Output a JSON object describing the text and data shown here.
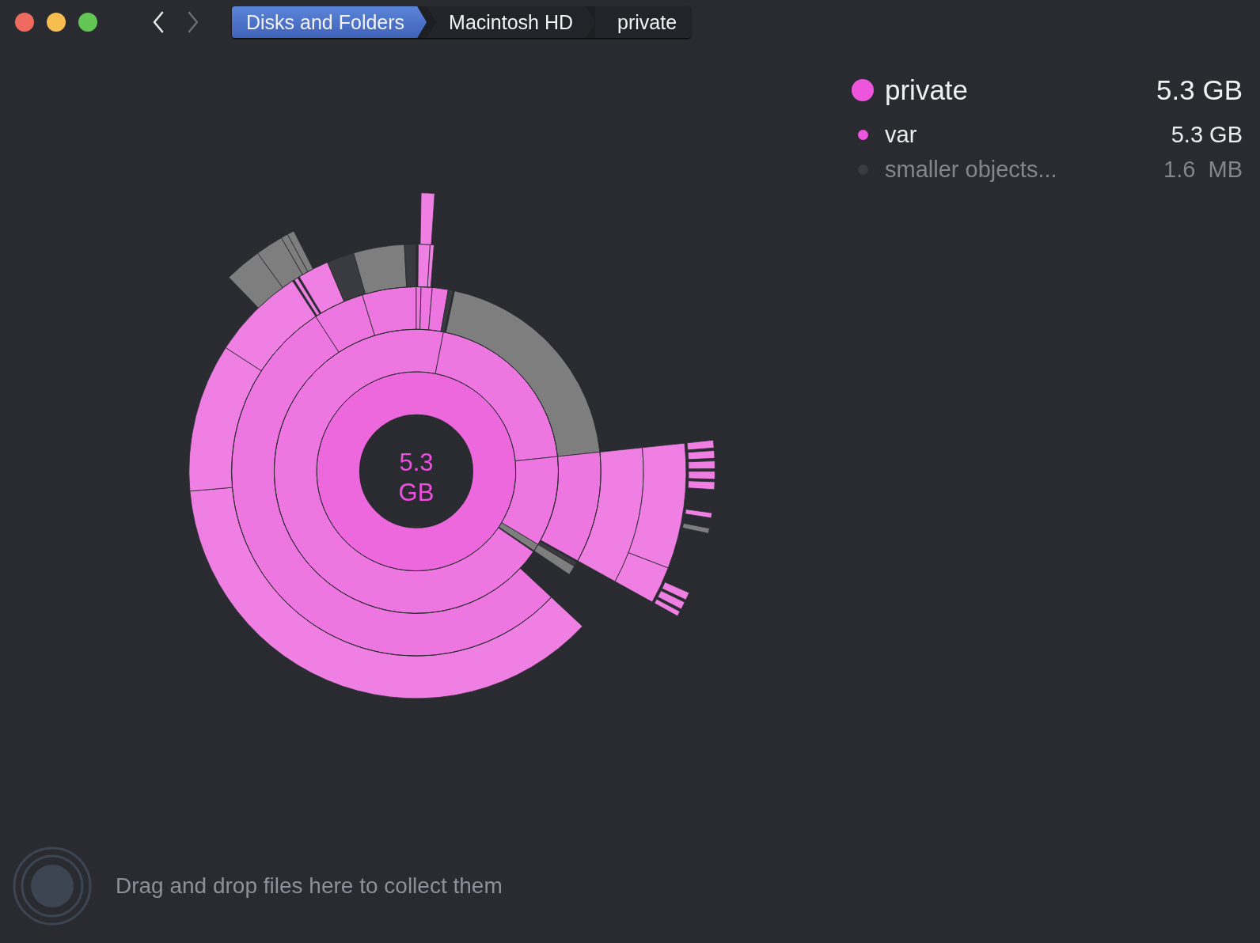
{
  "window": {
    "controls": [
      {
        "color": "#ee6a5f"
      },
      {
        "color": "#f5be4f"
      },
      {
        "color": "#62c554"
      }
    ]
  },
  "navigation": {
    "back": {
      "disabled": false
    },
    "forward": {
      "disabled": true
    }
  },
  "breadcrumb": [
    {
      "label": "Disks and Folders",
      "selected": true
    },
    {
      "label": "Macintosh HD",
      "selected": false
    },
    {
      "label": "private",
      "selected": false
    }
  ],
  "chart": {
    "center_label": "5.3 GB"
  },
  "legend": [
    {
      "kind": "total",
      "name": "private",
      "size": "5.3 GB",
      "color": "#ec55dc",
      "dimmed": false
    },
    {
      "kind": "item",
      "name": "var",
      "size": "5.3 GB",
      "color": "#ec55dc",
      "dimmed": false
    },
    {
      "kind": "item",
      "name": "smaller objects...",
      "size": "1.6  MB",
      "color": "#3b3c42",
      "dimmed": true
    }
  ],
  "drop_zone": {
    "text": "Drag and drop files here to collect them"
  }
}
